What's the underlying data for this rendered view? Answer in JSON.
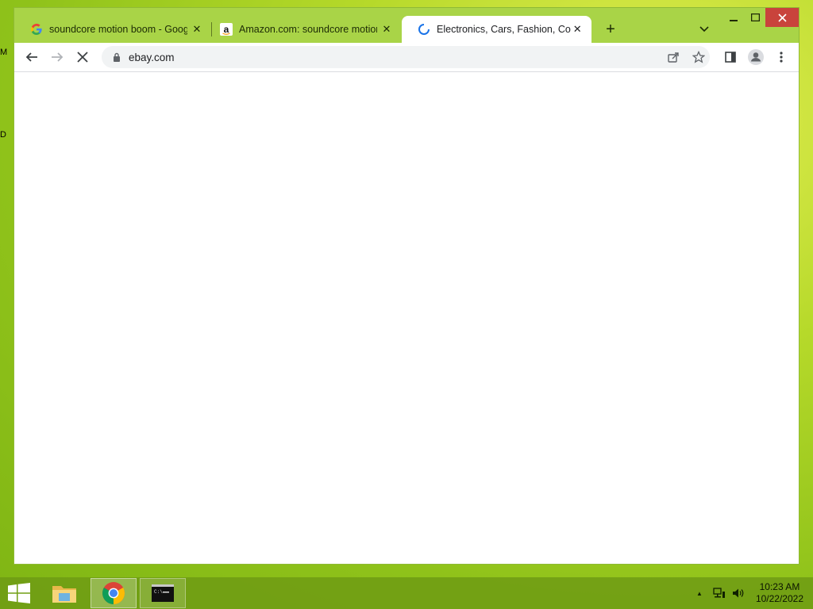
{
  "desktop": {
    "label_top": "M",
    "label_mid": "D"
  },
  "window": {
    "controls": {
      "minimize": "–",
      "maximize": "□",
      "close": "✕"
    },
    "tabs": [
      {
        "title": "soundcore motion boom - Google",
        "icon": "google-icon",
        "close": "✕"
      },
      {
        "title": "Amazon.com: soundcore motion",
        "icon": "amazon-icon",
        "close": "✕"
      },
      {
        "title": "Electronics, Cars, Fashion, Collect",
        "icon": "loading-spinner-icon",
        "close": "✕",
        "active": true
      }
    ],
    "new_tab": "+",
    "tab_search": "⌄"
  },
  "toolbar": {
    "back": "←",
    "forward": "→",
    "stop": "✕",
    "url": "ebay.com",
    "share": "share-icon",
    "bookmark": "☆",
    "side_panel": "side-panel-icon",
    "profile": "profile-icon",
    "menu": "⋮"
  },
  "taskbar": {
    "time": "10:23 AM",
    "date": "10/22/2022",
    "tray_arrow": "▲"
  },
  "colors": {
    "titlebar": "#a9d447",
    "close_button": "#c9433c",
    "taskbar": "#6e9b14"
  }
}
